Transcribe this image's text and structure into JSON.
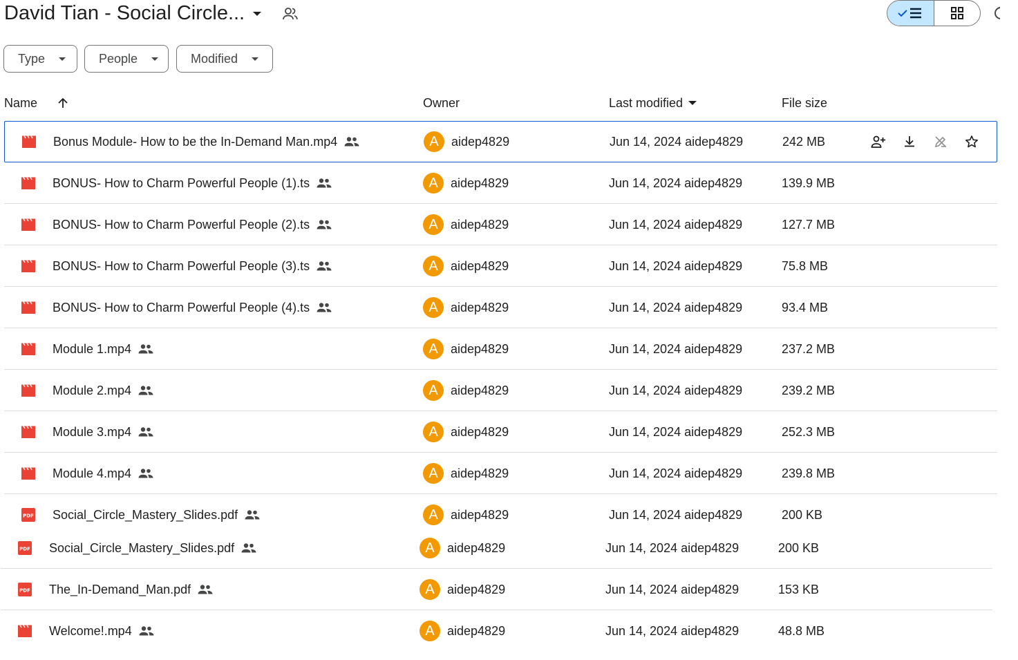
{
  "header": {
    "title": "David Tian - Social Circle...",
    "view_list_label": "List layout",
    "view_grid_label": "Grid layout"
  },
  "filters": [
    {
      "label": "Type"
    },
    {
      "label": "People"
    },
    {
      "label": "Modified"
    }
  ],
  "columns": {
    "name": "Name",
    "owner": "Owner",
    "modified": "Last modified",
    "size": "File size"
  },
  "rows": [
    {
      "name": "Bonus Module- How to be the In-Demand Man.mp4",
      "type": "video",
      "owner": "aidep4829",
      "owner_initial": "A",
      "modified": "Jun 14, 2024 aidep4829",
      "size": "242 MB",
      "selected": true
    },
    {
      "name": "BONUS- How to Charm Powerful People (1).ts",
      "type": "video",
      "owner": "aidep4829",
      "owner_initial": "A",
      "modified": "Jun 14, 2024 aidep4829",
      "size": "139.9 MB"
    },
    {
      "name": "BONUS- How to Charm Powerful People (2).ts",
      "type": "video",
      "owner": "aidep4829",
      "owner_initial": "A",
      "modified": "Jun 14, 2024 aidep4829",
      "size": "127.7 MB"
    },
    {
      "name": "BONUS- How to Charm Powerful People (3).ts",
      "type": "video",
      "owner": "aidep4829",
      "owner_initial": "A",
      "modified": "Jun 14, 2024 aidep4829",
      "size": "75.8 MB"
    },
    {
      "name": "BONUS- How to Charm Powerful People (4).ts",
      "type": "video",
      "owner": "aidep4829",
      "owner_initial": "A",
      "modified": "Jun 14, 2024 aidep4829",
      "size": "93.4 MB"
    },
    {
      "name": "Module 1.mp4",
      "type": "video",
      "owner": "aidep4829",
      "owner_initial": "A",
      "modified": "Jun 14, 2024 aidep4829",
      "size": "237.2 MB"
    },
    {
      "name": "Module 2.mp4",
      "type": "video",
      "owner": "aidep4829",
      "owner_initial": "A",
      "modified": "Jun 14, 2024 aidep4829",
      "size": "239.2 MB"
    },
    {
      "name": "Module 3.mp4",
      "type": "video",
      "owner": "aidep4829",
      "owner_initial": "A",
      "modified": "Jun 14, 2024 aidep4829",
      "size": "252.3 MB"
    },
    {
      "name": "Module 4.mp4",
      "type": "video",
      "owner": "aidep4829",
      "owner_initial": "A",
      "modified": "Jun 14, 2024 aidep4829",
      "size": "239.8 MB"
    },
    {
      "name": "Social_Circle_Mastery_Slides.pdf",
      "type": "pdf",
      "owner": "aidep4829",
      "owner_initial": "A",
      "modified": "Jun 14, 2024 aidep4829",
      "size": "200 KB"
    },
    {
      "name": "Social_Circle_Mastery_Slides.pdf",
      "type": "pdf",
      "owner": "aidep4829",
      "owner_initial": "A",
      "modified": "Jun 14, 2024 aidep4829",
      "size": "200 KB"
    },
    {
      "name": "The_In-Demand_Man.pdf",
      "type": "pdf",
      "owner": "aidep4829",
      "owner_initial": "A",
      "modified": "Jun 14, 2024 aidep4829",
      "size": "153 KB"
    },
    {
      "name": "Welcome!.mp4",
      "type": "video",
      "owner": "aidep4829",
      "owner_initial": "A",
      "modified": "Jun 14, 2024 aidep4829",
      "size": "48.8 MB"
    }
  ],
  "pdf_badge": "PDF",
  "row_actions": [
    "share-icon",
    "download-icon",
    "rename-icon",
    "star-icon"
  ],
  "colors": {
    "avatar": "#f29900",
    "video_icon": "#ea4335",
    "pdf_icon": "#ea4335",
    "selected_toggle": "#c2e7ff",
    "selection_border": "#0b57d0"
  }
}
